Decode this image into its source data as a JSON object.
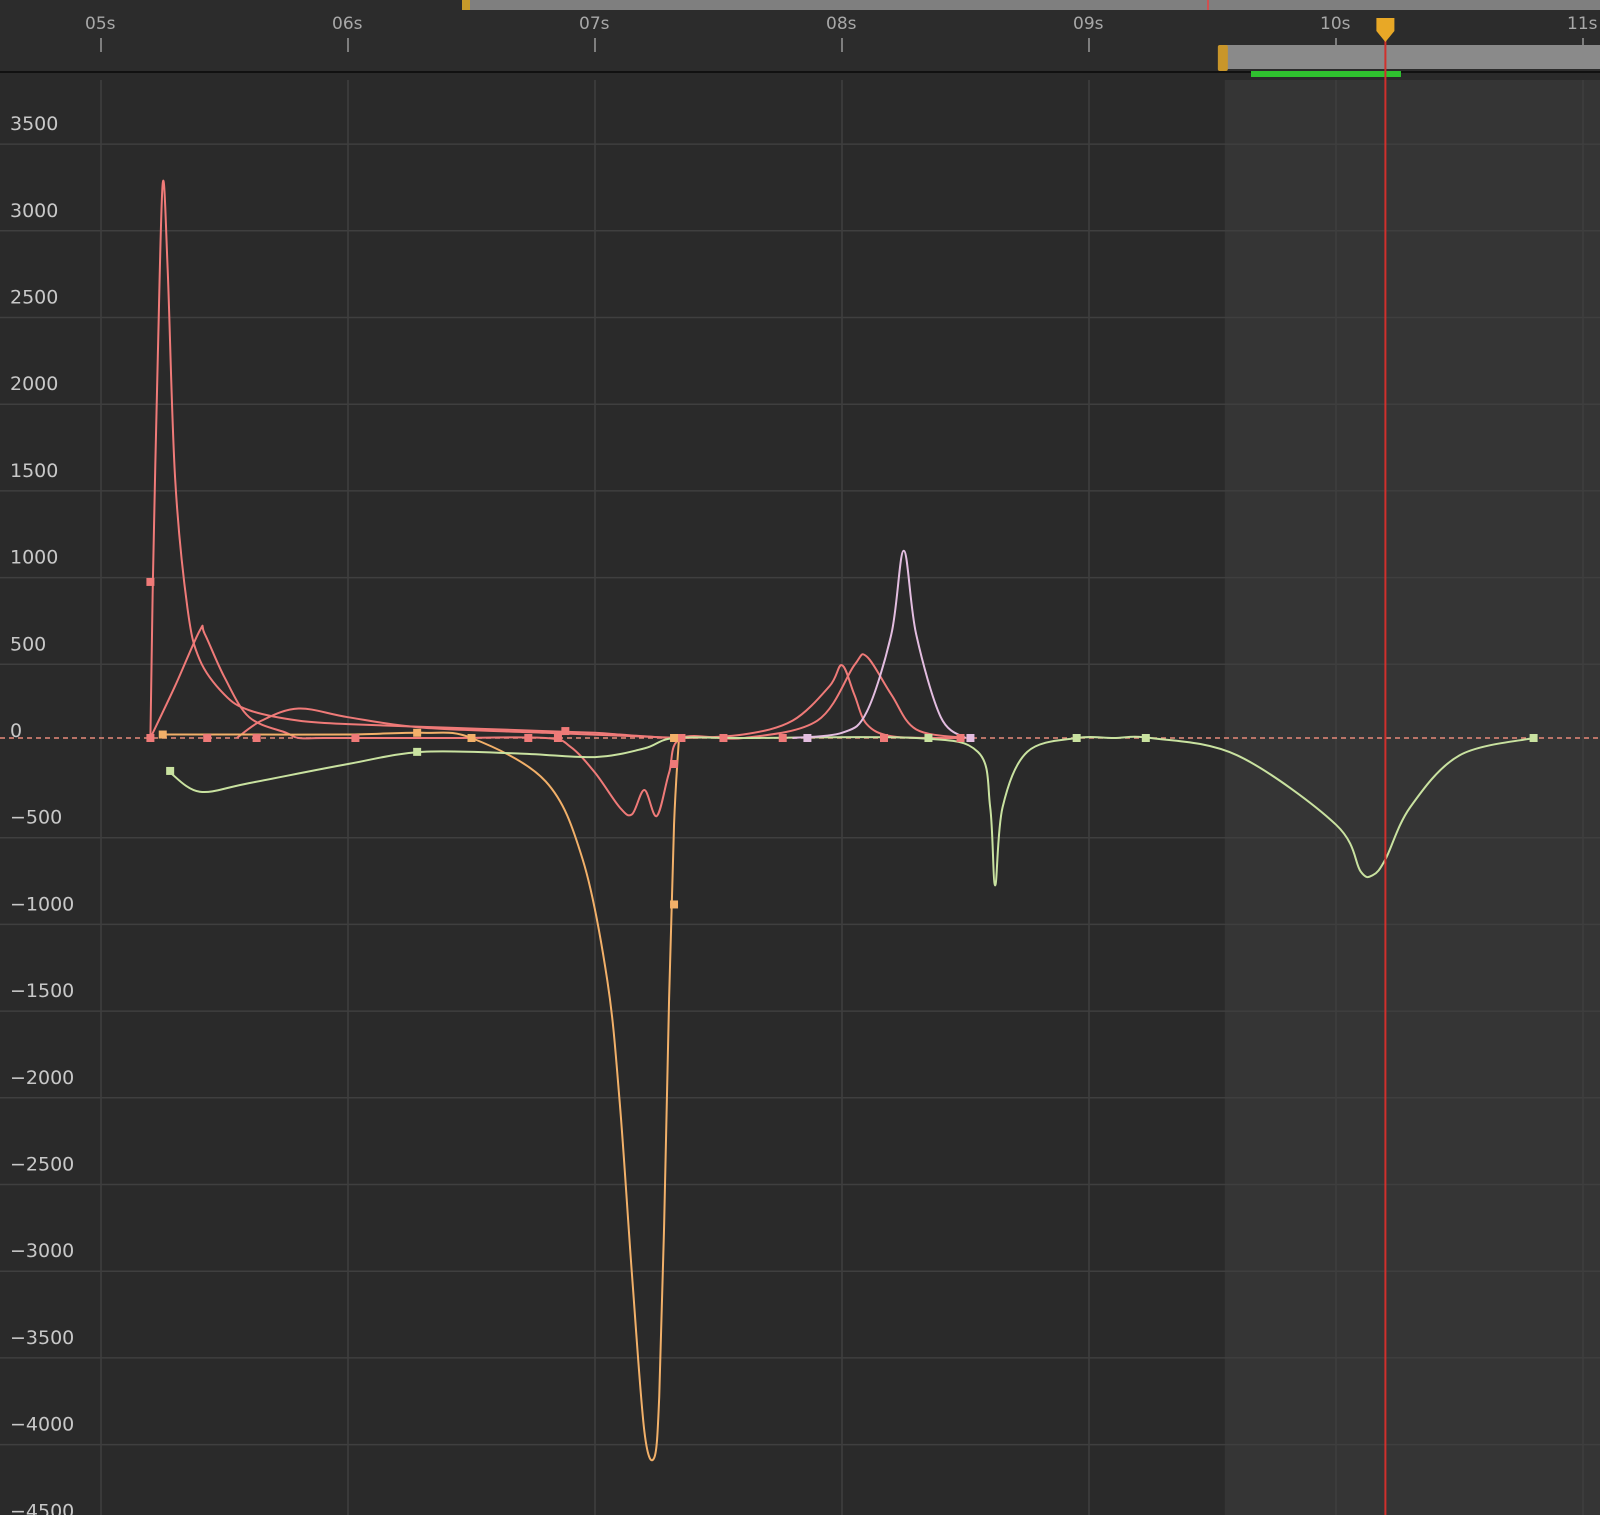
{
  "editor": {
    "time_ruler_labels": [
      "05s",
      "06s",
      "07s",
      "08s",
      "09s",
      "10s",
      "11s"
    ],
    "value_axis_labels": [
      "3500",
      "3000",
      "2500",
      "2000",
      "1500",
      "1000",
      "500",
      "0",
      "-500",
      "-1000",
      "-1500",
      "-2000",
      "-2500",
      "-3000",
      "-3500",
      "-4000",
      "-4500"
    ],
    "playhead_time_s": 10.2,
    "work_area_end_s": 9.55,
    "colors": {
      "background": "#2a2a2a",
      "grid": "#3f3f3f",
      "out_of_range": "#353535",
      "playhead": "#d0302c",
      "playhead_handle": "#e8a826",
      "work_area_bar": "#8a8a8a",
      "render_bar": "#2fc22f",
      "curve_red": "#ef7a78",
      "curve_orange": "#f2b069",
      "curve_green": "#c9e2a0",
      "curve_pink": "#e3bde0"
    },
    "icons": {
      "playhead_handle": "playhead-marker-icon",
      "work_area_handle": "grip-handle-icon"
    }
  },
  "chart_data": {
    "type": "line",
    "title": "",
    "xlabel": "",
    "ylabel": "",
    "x_unit": "s",
    "xlim": [
      4.6,
      11.1
    ],
    "ylim": [
      -4500,
      3700
    ],
    "series": [
      {
        "color": "#ef7a78",
        "x": [
          5.2,
          5.21,
          5.23,
          5.25,
          5.27,
          5.3,
          5.35,
          5.4,
          5.5,
          5.6,
          5.8,
          6.0,
          6.4,
          6.8,
          7.0,
          7.1,
          7.2,
          7.35,
          7.6,
          7.8,
          7.95,
          8.0,
          8.05,
          8.1,
          8.2,
          8.4,
          8.5
        ],
        "y": [
          0,
          900,
          2200,
          3200,
          2700,
          1500,
          750,
          450,
          250,
          160,
          100,
          80,
          60,
          40,
          30,
          20,
          10,
          0,
          20,
          100,
          300,
          420,
          250,
          80,
          10,
          0,
          0
        ]
      },
      {
        "color": "#ef7a78",
        "x": [
          5.2,
          5.3,
          5.4,
          5.42,
          5.5,
          5.6,
          5.75,
          5.8,
          5.9,
          6.1,
          6.4,
          6.8,
          6.9,
          7.0,
          7.1,
          7.15,
          7.2,
          7.25,
          7.3,
          7.35,
          7.6,
          7.9,
          8.05,
          8.1,
          8.2,
          8.3,
          8.5
        ],
        "y": [
          0,
          300,
          620,
          600,
          350,
          120,
          30,
          0,
          0,
          0,
          0,
          0,
          -50,
          -200,
          -400,
          -440,
          -300,
          -450,
          -200,
          0,
          0,
          100,
          420,
          470,
          250,
          50,
          0
        ]
      },
      {
        "color": "#ef7a78",
        "x": [
          5.55,
          5.65,
          5.8,
          6.0,
          6.3,
          6.8,
          7.35
        ],
        "y": [
          0,
          100,
          170,
          120,
          60,
          30,
          0
        ]
      },
      {
        "color": "#f2b069",
        "x": [
          5.25,
          5.6,
          6.0,
          6.3,
          6.5,
          6.8,
          6.95,
          7.05,
          7.1,
          7.15,
          7.2,
          7.24,
          7.26,
          7.28,
          7.3,
          7.32,
          7.34
        ],
        "y": [
          20,
          20,
          20,
          30,
          0,
          -250,
          -700,
          -1400,
          -2100,
          -3100,
          -4000,
          -4150,
          -3800,
          -2800,
          -1500,
          -500,
          0
        ]
      },
      {
        "color": "#c9e2a0",
        "x": [
          5.28,
          5.4,
          5.6,
          6.0,
          6.3,
          6.7,
          7.0,
          7.2,
          7.32,
          7.6,
          8.3,
          8.55,
          8.6,
          8.62,
          8.65,
          8.75,
          8.95,
          9.1,
          9.25,
          9.6,
          10.0,
          10.1,
          10.15,
          10.2,
          10.3,
          10.5,
          10.8
        ],
        "y": [
          -200,
          -310,
          -260,
          -150,
          -80,
          -90,
          -110,
          -60,
          0,
          0,
          0,
          -80,
          -400,
          -850,
          -400,
          -80,
          0,
          0,
          0,
          -100,
          -500,
          -770,
          -790,
          -700,
          -400,
          -100,
          0
        ]
      },
      {
        "color": "#e3bde0",
        "x": [
          7.8,
          8.0,
          8.1,
          8.2,
          8.25,
          8.3,
          8.4,
          8.5
        ],
        "y": [
          0,
          30,
          150,
          600,
          1080,
          600,
          120,
          0
        ]
      }
    ],
    "keyframes": [
      {
        "color": "#ef7a78",
        "x": [
          5.2,
          5.2,
          5.43,
          5.63,
          6.03,
          6.73,
          6.85,
          6.88,
          7.35,
          7.52,
          7.76,
          8.17,
          8.48,
          7.32
        ]
      },
      {
        "color": "#ef7a78",
        "y_note": "",
        "x_values_y": [
          0,
          900,
          0,
          0,
          0,
          0,
          0,
          40,
          0,
          0,
          0,
          0,
          0,
          -150
        ]
      },
      {
        "color": "#f2b069",
        "x": [
          5.25,
          6.28,
          6.5,
          7.32,
          7.32
        ],
        "y": [
          20,
          30,
          0,
          0,
          -960
        ]
      },
      {
        "color": "#c9e2a0",
        "x": [
          5.28,
          6.28,
          8.35,
          8.95,
          9.23,
          10.8
        ],
        "y": [
          -200,
          -80,
          0,
          0,
          0,
          0
        ]
      },
      {
        "color": "#e3bde0",
        "x": [
          7.86,
          8.52
        ],
        "y": [
          0,
          0
        ]
      }
    ]
  }
}
